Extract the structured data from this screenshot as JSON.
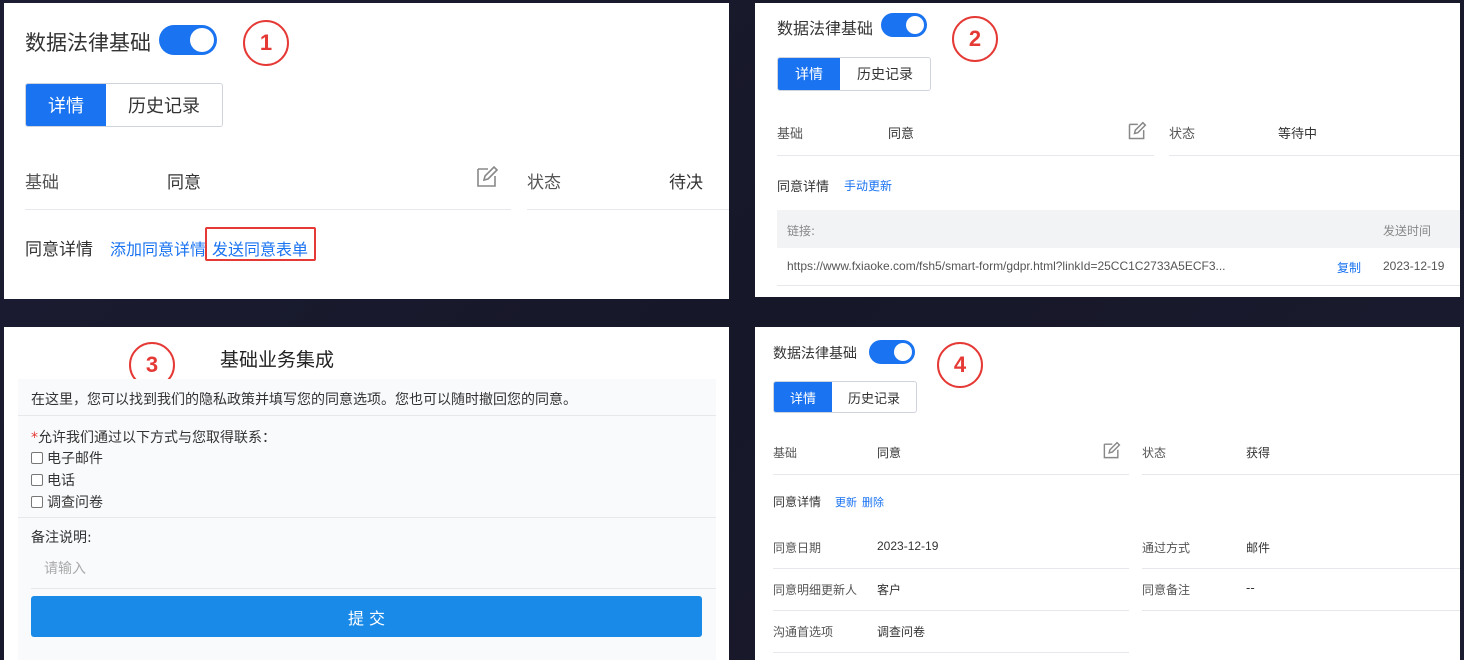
{
  "colors": {
    "accent": "#1a73f0",
    "step_red": "#e53935",
    "submit_blue": "#1a8ae8"
  },
  "panel1": {
    "step": "1",
    "title": "数据法律基础",
    "tabs": [
      "详情",
      "历史记录"
    ],
    "basis_label": "基础",
    "basis_value": "同意",
    "status_label": "状态",
    "status_value": "待决",
    "consent_detail_label": "同意详情",
    "add_link": "添加同意详情",
    "send_link": "发送同意表单"
  },
  "panel2": {
    "step": "2",
    "title": "数据法律基础",
    "tabs": [
      "详情",
      "历史记录"
    ],
    "basis_label": "基础",
    "basis_value": "同意",
    "status_label": "状态",
    "status_value": "等待中",
    "consent_detail_label": "同意详情",
    "manual_update_link": "手动更新",
    "table": {
      "col_link": "链接:",
      "col_time": "发送时间",
      "row_url": "https://www.fxiaoke.com/fsh5/smart-form/gdpr.html?linkId=25CC1C2733A5ECF3...",
      "row_copy": "复制",
      "row_time": "2023-12-19"
    }
  },
  "panel3": {
    "step": "3",
    "title": "基础业务集成",
    "intro": "在这里，您可以找到我们的隐私政策并填写您的同意选项。您也可以随时撤回您的同意。",
    "required_mark": "*",
    "question": "允许我们通过以下方式与您取得联系：",
    "options": [
      "电子邮件",
      "电话",
      "调查问卷"
    ],
    "notes_label": "备注说明:",
    "notes_placeholder": "请输入",
    "submit_label": "提 交"
  },
  "panel4": {
    "step": "4",
    "title": "数据法律基础",
    "tabs": [
      "详情",
      "历史记录"
    ],
    "basis_label": "基础",
    "basis_value": "同意",
    "status_label": "状态",
    "status_value": "获得",
    "consent_detail_label": "同意详情",
    "update_link": "更新",
    "delete_link": "删除",
    "fields": [
      {
        "label": "同意日期",
        "value": "2023-12-19"
      },
      {
        "label": "通过方式",
        "value": "邮件"
      },
      {
        "label": "同意明细更新人",
        "value": "客户"
      },
      {
        "label": "同意备注",
        "value": "--"
      },
      {
        "label": "沟通首选项",
        "value": "调查问卷"
      }
    ]
  }
}
